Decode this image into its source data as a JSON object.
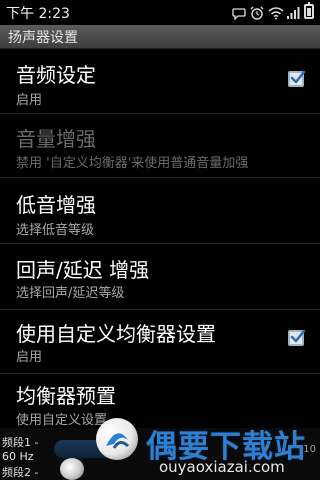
{
  "status_bar": {
    "time": "下午 2:23",
    "icons": [
      "chat-icon",
      "alarm-icon",
      "wifi-icon",
      "signal-icon",
      "battery-icon"
    ]
  },
  "title_bar": {
    "title": "扬声器设置"
  },
  "preferences": [
    {
      "title": "音频设定",
      "summary": "启用",
      "checked": true,
      "enabled": true
    },
    {
      "title": "音量增强",
      "summary": "禁用 '自定义均衡器'来使用普通音量加强",
      "checked": null,
      "enabled": false
    },
    {
      "title": "低音增强",
      "summary": "选择低音等级",
      "checked": null,
      "enabled": true
    },
    {
      "title": "回声/延迟 增强",
      "summary": "选择回声/延迟等级",
      "checked": null,
      "enabled": true
    },
    {
      "title": "使用自定义均衡器设置",
      "summary": "启用",
      "checked": true,
      "enabled": true
    },
    {
      "title": "均衡器预置",
      "summary": "使用自定义设置",
      "checked": null,
      "enabled": true
    }
  ],
  "equalizer_strip": {
    "band1_label": "频段1 -",
    "band1_freq": "60 Hz",
    "band2_label": "频段2 -",
    "right_value": "10"
  },
  "watermark": {
    "brand": "偶要下载站",
    "url": "ouyaoxiazai.com"
  },
  "colors": {
    "title_bar": "#4a4a4a",
    "checkbox_border": "#9fb4c8",
    "check_mark": "#2a6fb8",
    "watermark_blue": "#2f7fd0"
  }
}
